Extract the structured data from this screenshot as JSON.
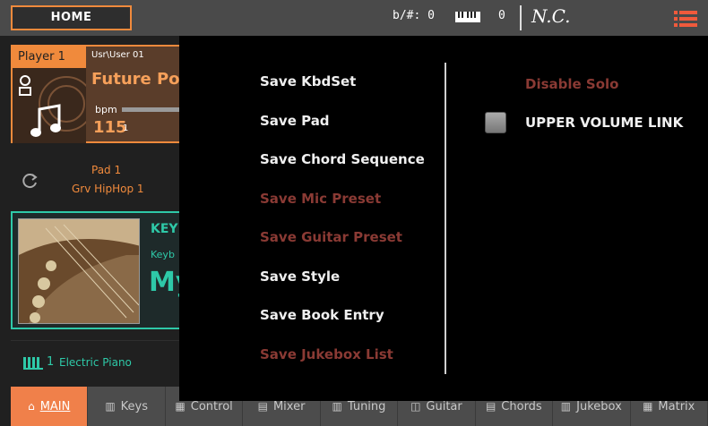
{
  "header": {
    "home_label": "HOME",
    "key_signature": "b/#: 0",
    "transpose": "0",
    "chord": "N.C."
  },
  "player": {
    "tab_label": "Player 1",
    "user_path": "Usr\\User 01",
    "song_title": "Future Po",
    "bpm_label": "bpm",
    "bpm_value": "115",
    "bpm_sub": "1"
  },
  "pad": {
    "label": "Pad 1",
    "sound": "Grv HipHop 1"
  },
  "keyboard": {
    "title": "KEY",
    "subtitle": "Keyb",
    "big_text": "My"
  },
  "track": {
    "number": "1",
    "name": "Electric Piano"
  },
  "bottom_tabs": [
    {
      "icon": "home-icon",
      "glyph": "⌂",
      "label": "MAIN"
    },
    {
      "icon": "keys-icon",
      "glyph": "▥",
      "label": "Keys"
    },
    {
      "icon": "control-icon",
      "glyph": "▦",
      "label": "Control"
    },
    {
      "icon": "mixer-icon",
      "glyph": "▤",
      "label": "Mixer"
    },
    {
      "icon": "tuning-icon",
      "glyph": "▥",
      "label": "Tuning"
    },
    {
      "icon": "guitar-icon",
      "glyph": "◫",
      "label": "Guitar"
    },
    {
      "icon": "chords-icon",
      "glyph": "▤",
      "label": "Chords"
    },
    {
      "icon": "jukebox-icon",
      "glyph": "▥",
      "label": "Jukebox"
    },
    {
      "icon": "matrix-icon",
      "glyph": "▦",
      "label": "Matrix"
    }
  ],
  "menu": {
    "items": [
      {
        "label": "Save KbdSet",
        "enabled": true
      },
      {
        "label": "Save Pad",
        "enabled": true
      },
      {
        "label": "Save Chord Sequence",
        "enabled": true
      },
      {
        "label": "Save Mic Preset",
        "enabled": false
      },
      {
        "label": "Save Guitar Preset",
        "enabled": false
      },
      {
        "label": "Save Style",
        "enabled": true
      },
      {
        "label": "Save Book Entry",
        "enabled": true
      },
      {
        "label": "Save Jukebox List",
        "enabled": false
      }
    ],
    "disable_solo": "Disable Solo",
    "upper_volume_link": "UPPER VOLUME LINK"
  },
  "colors": {
    "accent": "#f08a3c",
    "teal": "#2ec9a8",
    "disabled": "#8a3a34"
  }
}
